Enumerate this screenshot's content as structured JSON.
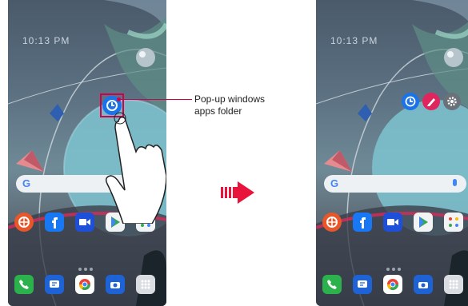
{
  "phones": {
    "left": {
      "clock": "10:13 PM"
    },
    "right": {
      "clock": "10:13 PM"
    }
  },
  "callout": {
    "line1": "Pop-up windows",
    "line2": "apps folder"
  },
  "search": {
    "logo": "G"
  },
  "colors": {
    "accent": "#d2004c",
    "arrow": "#e8143c",
    "folder": "#1a73e8"
  },
  "home_apps": [
    "globe-icon",
    "facebook-icon",
    "video-icon",
    "play-store-icon",
    "app-grid-icon"
  ],
  "dock_apps": [
    "phone-icon",
    "messages-icon",
    "chrome-icon",
    "camera-icon",
    "apps-drawer-icon"
  ],
  "popup_apps": [
    "clock-icon",
    "pencil-icon",
    "gear-icon"
  ]
}
